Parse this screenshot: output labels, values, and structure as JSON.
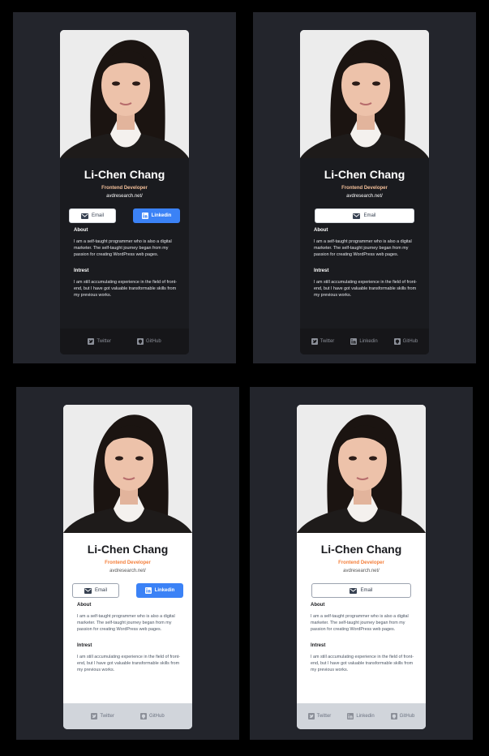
{
  "profile": {
    "name": "Li-Chen Chang",
    "role": "Frontend Developer",
    "website": "avdresearch.net/",
    "email_label": "Email",
    "linkedin_label": "Linkedin",
    "about_heading": "About",
    "about_text": "I am a self-taught programmer who is also a digital marketer. The self-taught journey began from my passion for creating WordPress web pages.",
    "interest_heading": "Intrest",
    "interest_text": "I am still accumulating experience in the field of front-end, but I have got valuable transformable skills from my previous works."
  },
  "footer": {
    "twitter": "Twitter",
    "linkedin": "Linkedin",
    "github": "GitHub"
  },
  "colors": {
    "accent_blue": "#3b82f6",
    "role_dark": "#f3bf99",
    "role_light": "#f47f3b",
    "panel_bg": "#23252c"
  },
  "variants": [
    "dark-with-linkedin-button",
    "dark-email-only",
    "light-with-linkedin-button",
    "light-email-only"
  ]
}
